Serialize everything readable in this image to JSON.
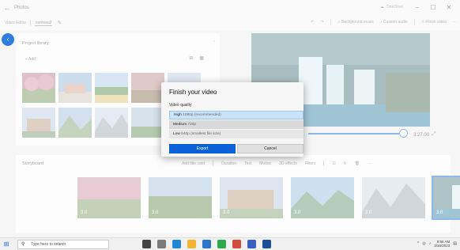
{
  "window": {
    "app_title": "Photos",
    "onedrive_label": "OneDrive",
    "controls": {
      "minimize": "–",
      "maximize": "☐",
      "close": "✕"
    }
  },
  "toolbar": {
    "breadcrumb_root": "Video Editor",
    "project_name": "contoso2",
    "undo_icon": "undo-icon",
    "redo_icon": "redo-icon",
    "background_music": "Background music",
    "custom_audio": "Custom audio",
    "finish_video": "Finish video",
    "more": "···"
  },
  "library": {
    "title": "Project library",
    "add_label": "+ Add",
    "view_icons": [
      "grid-view-icon",
      "list-view-icon"
    ]
  },
  "preview": {
    "time": "3:27.00"
  },
  "storyboard": {
    "title": "Storyboard",
    "tools": [
      "Add title card",
      "Duration",
      "Text",
      "Motion",
      "3D effects",
      "Filters"
    ],
    "clip_durations": [
      "3.0",
      "3.0",
      "3.0",
      "3.0",
      "3.0",
      "3.0"
    ]
  },
  "dialog": {
    "title": "Finish your video",
    "quality_label": "Video quality",
    "options": [
      {
        "name": "High",
        "detail": "1080p (recommended)"
      },
      {
        "name": "Medium",
        "detail": "720p"
      },
      {
        "name": "Low",
        "detail": "540p (smallest file size)"
      }
    ],
    "export_label": "Export",
    "cancel_label": "Cancel"
  },
  "taskbar": {
    "search_placeholder": "Type here to search",
    "time": "8:56 AM",
    "date": "3/16/2023"
  },
  "colors": {
    "accent": "#0b62d6",
    "selected_option": "#cbe3f9"
  }
}
